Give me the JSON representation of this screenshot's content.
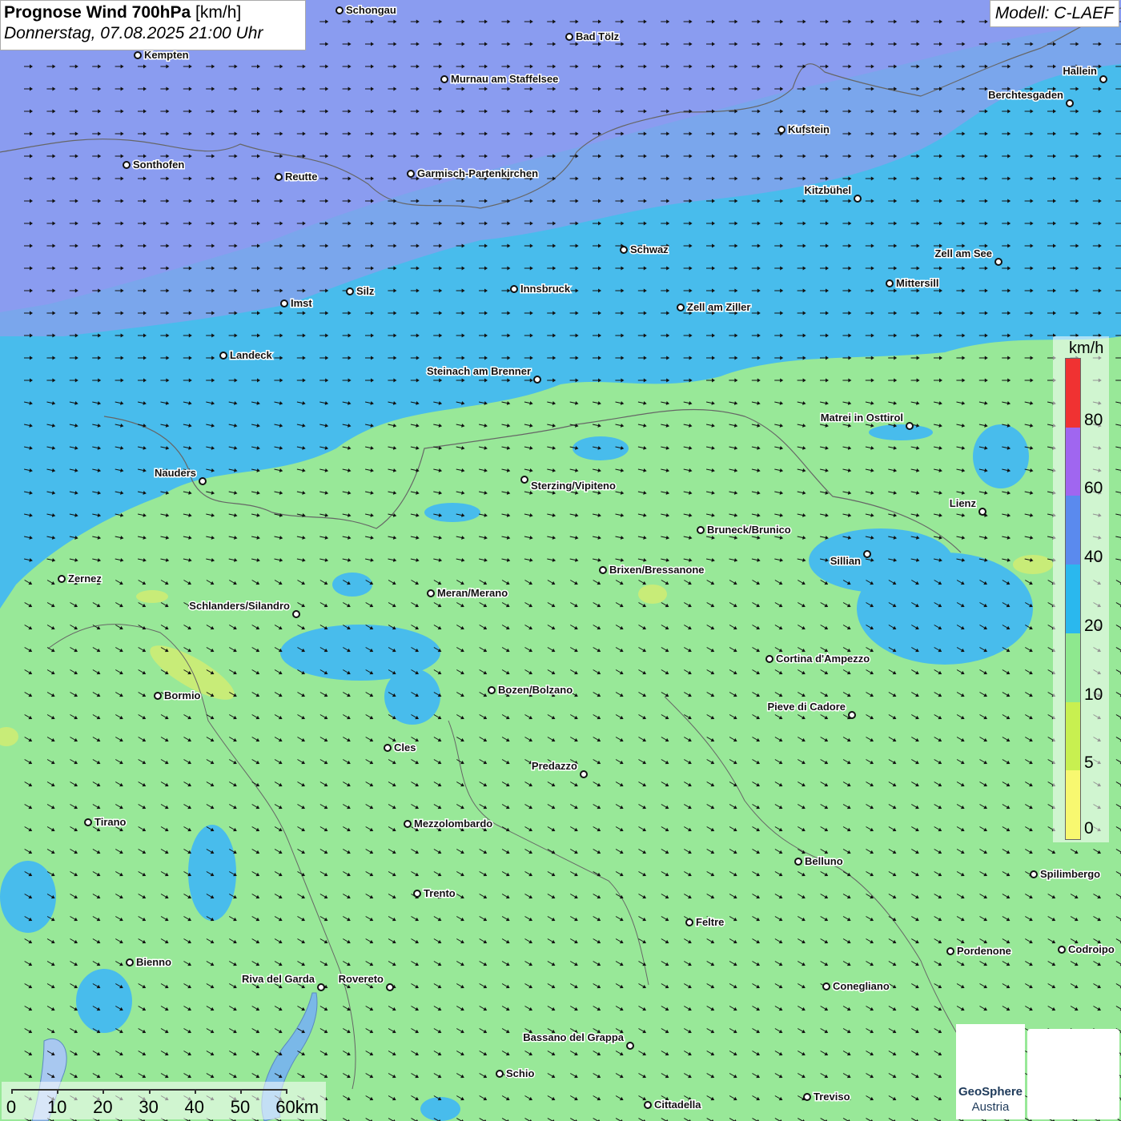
{
  "header": {
    "title_bold": "Prognose Wind 700hPa",
    "title_unit": " [km/h]",
    "subtitle": "Donnerstag, 07.08.2025 21:00 Uhr",
    "model": "Modell: C-LAEF"
  },
  "legend": {
    "unit": "km/h",
    "labels": [
      "80",
      "60",
      "40",
      "20",
      "10",
      "5",
      "0"
    ],
    "colors": [
      "#f03232",
      "#a066f0",
      "#5a8aee",
      "#2ab8ee",
      "#8ee88e",
      "#c8f050",
      "#f8f870"
    ]
  },
  "scale_bar": {
    "labels": [
      "0",
      "10",
      "20",
      "30",
      "40",
      "50",
      "60km"
    ]
  },
  "logos": {
    "geosphere_line1": "GeoSphere",
    "geosphere_line2": "Austria"
  },
  "towns": [
    {
      "name": "Schongau"
    },
    {
      "name": "Bad Tölz"
    },
    {
      "name": "Kempten"
    },
    {
      "name": "Murnau am Staffelsee"
    },
    {
      "name": "Hallein"
    },
    {
      "name": "Berchtesgaden"
    },
    {
      "name": "Kufstein"
    },
    {
      "name": "Sonthofen"
    },
    {
      "name": "Reutte"
    },
    {
      "name": "Garmisch-Partenkirchen"
    },
    {
      "name": "Kitzbühel"
    },
    {
      "name": "Schwaz"
    },
    {
      "name": "Zell am See"
    },
    {
      "name": "Mittersill"
    },
    {
      "name": "Innsbruck"
    },
    {
      "name": "Silz"
    },
    {
      "name": "Imst"
    },
    {
      "name": "Zell am Ziller"
    },
    {
      "name": "Landeck"
    },
    {
      "name": "Steinach am Brenner"
    },
    {
      "name": "Matrei in Osttirol"
    },
    {
      "name": "Nauders"
    },
    {
      "name": "Sterzing/Vipiteno"
    },
    {
      "name": "Lienz"
    },
    {
      "name": "Bruneck/Brunico"
    },
    {
      "name": "Sillian"
    },
    {
      "name": "Zernez"
    },
    {
      "name": "Brixen/Bressanone"
    },
    {
      "name": "Meran/Merano"
    },
    {
      "name": "Schlanders/Silandro"
    },
    {
      "name": "Cortina d'Ampezzo"
    },
    {
      "name": "Bormio"
    },
    {
      "name": "Bozen/Bolzano"
    },
    {
      "name": "Pieve di Cadore"
    },
    {
      "name": "Cles"
    },
    {
      "name": "Predazzo"
    },
    {
      "name": "Tirano"
    },
    {
      "name": "Mezzolombardo"
    },
    {
      "name": "Belluno"
    },
    {
      "name": "Spilimbergo"
    },
    {
      "name": "Trento"
    },
    {
      "name": "Feltre"
    },
    {
      "name": "Pordenone"
    },
    {
      "name": "Codroipo"
    },
    {
      "name": "Bienno"
    },
    {
      "name": "Riva del Garda"
    },
    {
      "name": "Rovereto"
    },
    {
      "name": "Conegliano"
    },
    {
      "name": "Bassano del Grappa"
    },
    {
      "name": "Schio"
    },
    {
      "name": "Treviso"
    },
    {
      "name": "Cittadella"
    }
  ]
}
